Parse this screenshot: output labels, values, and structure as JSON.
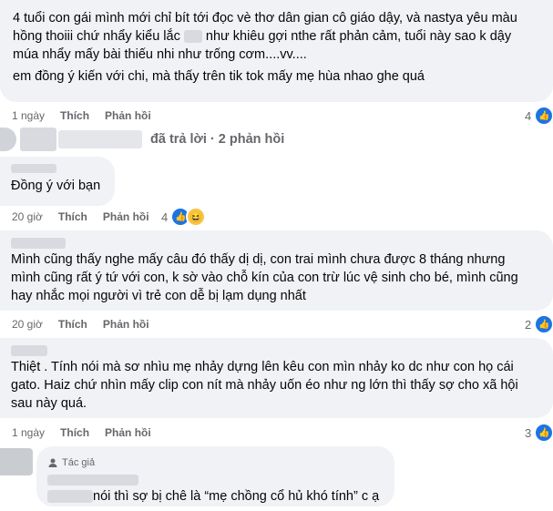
{
  "comment1": {
    "text": "4 tuổi con gái mình mới chỉ bít tới đọc vè thơ dân gian cô giáo dậy, và nastya yêu màu hồng thoiii chứ nhẩy kiểu lắc  như khiêu gợi nthe rất phản cảm, tuổi này sao k dậy múa nhẩy mấy bài thiếu nhi như trống cơm....vv....\nem đồng ý kiến với chi, mà thấy trên tik tok mấy mẹ hùa nhao ghe quá",
    "line1": "4 tuổi con gái mình mới chỉ bít tới đọc vè thơ dân gian cô giáo dậy, và nastya yêu màu",
    "line2a": "hồng thoiii chứ nhẩy kiểu lắc",
    "line2b": "như khiêu gợi nthe rất phản cảm, tuổi này sao k dậy",
    "line3": "múa nhẩy mấy bài thiếu nhi như trống cơm....vv....",
    "line4": "em đồng ý kiến với chi, mà thấy trên tik tok mấy mẹ hùa nhao ghe quá",
    "time": "1 ngày",
    "like": "Thích",
    "reply": "Phản hồi",
    "reactions": "4"
  },
  "replies_link": "đã trả lời · 2 phản hồi",
  "comment2": {
    "text": "Đồng ý với bạn",
    "time": "20 giờ",
    "like": "Thích",
    "reply": "Phản hồi",
    "reactions": "4"
  },
  "comment3": {
    "line1": "Mình cũng thấy nghe mấy câu đó thấy dị dị, con trai mình chưa được 8 tháng nhưng",
    "line2": "mình cũng rất ý tứ với con, k sờ vào chỗ kín của con trừ lúc vệ sinh cho bé, mình cũng",
    "line3": "hay nhắc mọi người vì trẻ con dễ bị lạm dụng nhất",
    "time": "20 giờ",
    "like": "Thích",
    "reply": "Phản hồi",
    "reactions": "2"
  },
  "comment4": {
    "line1": "Thiệt . Tính nói mà sơ nhìu mẹ nhảy dựng lên kêu con mìn nhảy ko dc như con họ cái",
    "line2": "gato. Haiz chứ nhìn mấy clip con nít mà nhảy uốn éo như ng lớn thì thấy sợ cho xã hội",
    "line3": "sau này quá.",
    "time": "1 ngày",
    "like": "Thích",
    "reply": "Phản hồi",
    "reactions": "3"
  },
  "comment5": {
    "author_badge": "Tác giả",
    "text": "nói thì sợ bị chê là “mẹ chồng cổ hủ khó tính” c ạ"
  },
  "colors": {
    "bubble": "#f0f2f5",
    "like_blue": "#1b74e4",
    "meta": "#65676b"
  },
  "icons": {
    "like": "like-icon",
    "haha": "haha-icon",
    "author": "author-badge-icon"
  }
}
